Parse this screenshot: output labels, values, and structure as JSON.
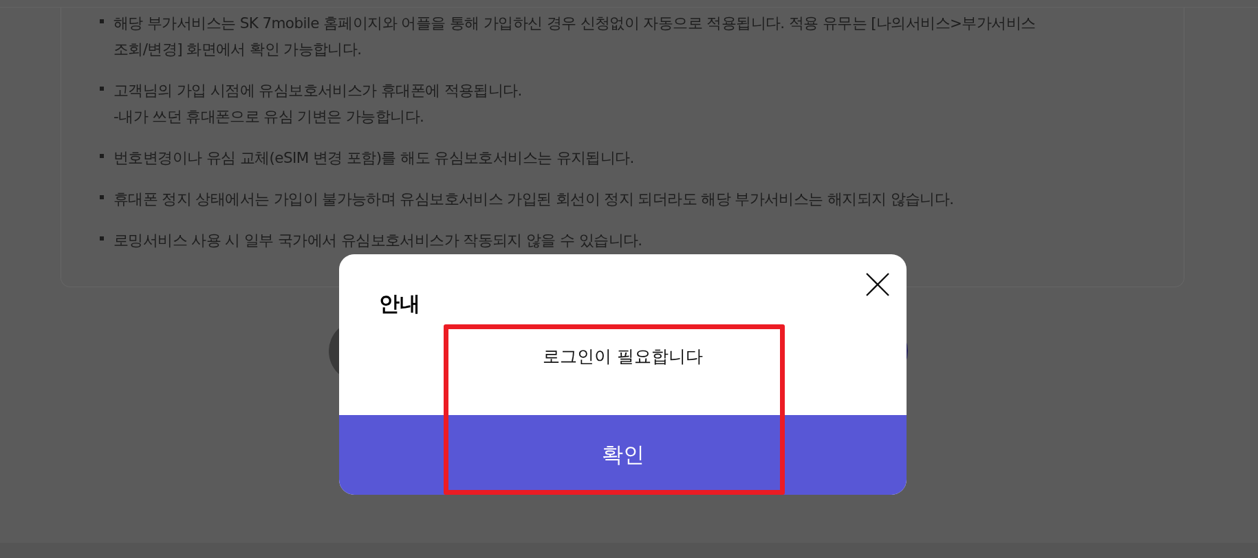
{
  "notice_list": [
    {
      "lines": [
        "해당 부가서비스는 SK 7mobile 홈페이지와 어플을 통해 가입하신 경우 신청없이 자동으로 적용됩니다. 적용 유무는 [나의서비스>부가서비스",
        "조회/변경] 화면에서 확인 가능합니다."
      ]
    },
    {
      "lines": [
        "고객님의 가입 시점에 유심보호서비스가 휴대폰에 적용됩니다.",
        "-내가 쓰던 휴대폰으로 유심 기변은 가능합니다."
      ]
    },
    {
      "lines": [
        "번호변경이나 유심 교체(eSIM 변경 포함)를 해도 유심보호서비스는 유지됩니다."
      ]
    },
    {
      "lines": [
        "휴대폰 정지 상태에서는 가입이 불가능하며 유심보호서비스 가입된 회선이 정지 되더라도 해당 부가서비스는 해지되지 않습니다."
      ]
    },
    {
      "lines": [
        "로밍서비스 사용 시 일부 국가에서 유심보호서비스가 작동되지 않을 수 있습니다."
      ]
    }
  ],
  "dialog": {
    "title": "안내",
    "message": "로그인이 필요합니다",
    "confirm_button": "확인"
  }
}
